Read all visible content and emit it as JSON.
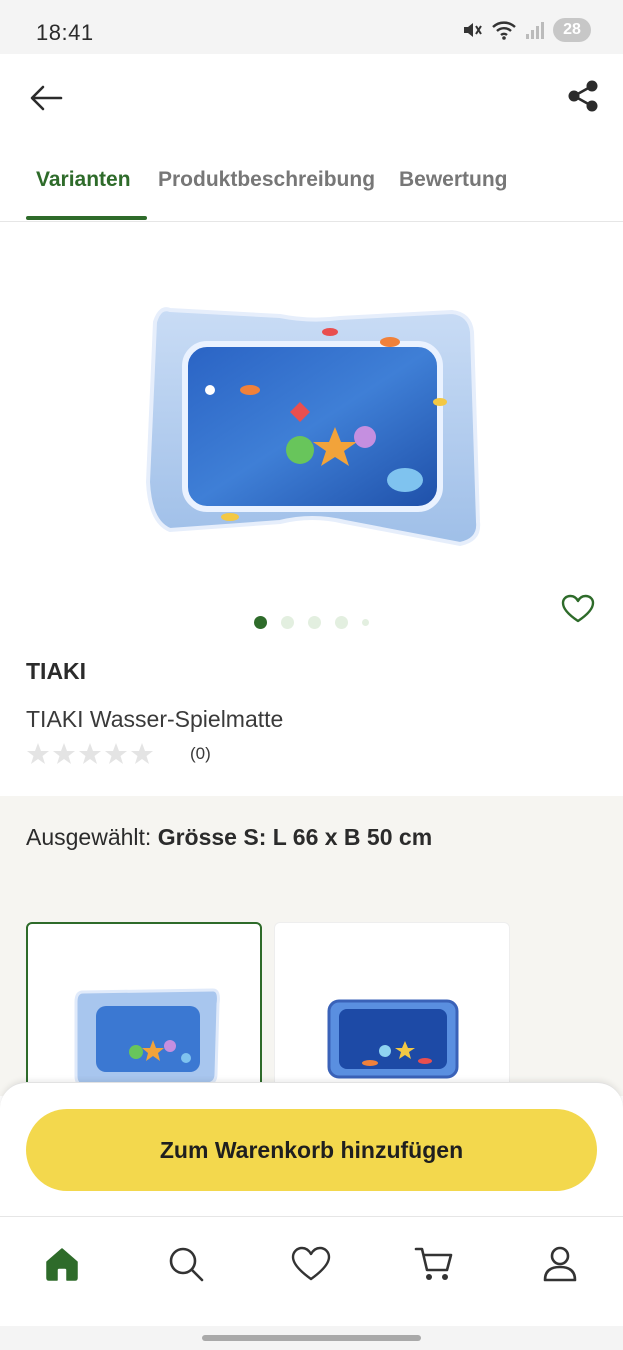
{
  "status_bar": {
    "time": "18:41",
    "battery": "28",
    "icons": [
      "mute-icon",
      "wifi-icon",
      "signal-icon"
    ]
  },
  "app_bar": {
    "back_icon": "arrow-left-icon",
    "share_icon": "share-icon"
  },
  "tabs": [
    {
      "label": "Varianten",
      "active": true
    },
    {
      "label": "Produktbeschreibung",
      "active": false
    },
    {
      "label": "Bewertung",
      "active": false
    }
  ],
  "gallery": {
    "image": "inflatable water play mat with fish",
    "current": 1,
    "total": 5
  },
  "product": {
    "brand": "TIAKI",
    "name": "TIAKI Wasser-Spielmatte",
    "rating": 0,
    "rating_count": "(0)"
  },
  "variants": {
    "selected_prefix": "Ausgewählt:",
    "selected_value": "Grösse S: L 66 x B 50 cm",
    "options": [
      {
        "image": "light blue water mat",
        "selected": true
      },
      {
        "image": "dark blue water mat",
        "selected": false
      }
    ]
  },
  "cart": {
    "button_label": "Zum Warenkorb hinzufügen"
  },
  "bottom_nav": [
    {
      "icon": "home-icon",
      "active": true
    },
    {
      "icon": "search-icon",
      "active": false
    },
    {
      "icon": "heart-icon",
      "active": false
    },
    {
      "icon": "cart-icon",
      "active": false
    },
    {
      "icon": "profile-icon",
      "active": false
    }
  ],
  "colors": {
    "accent_green": "#2e6b2a",
    "cart_yellow": "#f3d84d",
    "section_bg": "#f6f5f1"
  }
}
